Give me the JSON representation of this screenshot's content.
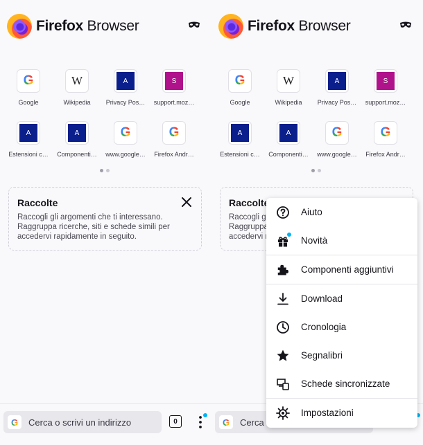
{
  "header": {
    "brand_bold": "Firefox",
    "brand_light": "Browser"
  },
  "shortcuts": [
    {
      "label": "Google",
      "icon": "google"
    },
    {
      "label": "Wikipedia",
      "icon": "wikipedia"
    },
    {
      "label": "Privacy Pos…",
      "icon": "letter",
      "letter": "A",
      "color": "#0a1e8c"
    },
    {
      "label": "support.moz…",
      "icon": "letter",
      "letter": "S",
      "color": "#b0128c"
    },
    {
      "label": "Estensioni c…",
      "icon": "letter",
      "letter": "A",
      "color": "#0a1e8c"
    },
    {
      "label": "Componenti…",
      "icon": "letter",
      "letter": "A",
      "color": "#0a1e8c"
    },
    {
      "label": "www.google…",
      "icon": "google"
    },
    {
      "label": "Firefox Andr…",
      "icon": "google"
    }
  ],
  "collections": {
    "title": "Raccolte",
    "text_line1": "Raccogli gli argomenti che ti interessano.",
    "text_line2": "Raggruppa ricerche, siti e schede simili per",
    "text_line3": "accedervi rapidamente in seguito."
  },
  "toolbar": {
    "placeholder": "Cerca o scrivi un indirizzo",
    "placeholder_cut": "Cerca",
    "tab_count": "0"
  },
  "menu": {
    "items": [
      {
        "label": "Aiuto",
        "icon": "help-icon"
      },
      {
        "label": "Novità",
        "icon": "gift-icon"
      },
      {
        "label": "Componenti aggiuntivi",
        "icon": "puzzle-icon"
      },
      {
        "label": "Download",
        "icon": "download-icon"
      },
      {
        "label": "Cronologia",
        "icon": "clock-icon"
      },
      {
        "label": "Segnalibri",
        "icon": "star-icon"
      },
      {
        "label": "Schede sincronizzate",
        "icon": "devices-icon"
      },
      {
        "label": "Impostazioni",
        "icon": "gear-icon"
      }
    ]
  },
  "colors": {
    "accent_dot": "#00b3f4",
    "text": "#15141a",
    "background": "#f9f9fb"
  }
}
